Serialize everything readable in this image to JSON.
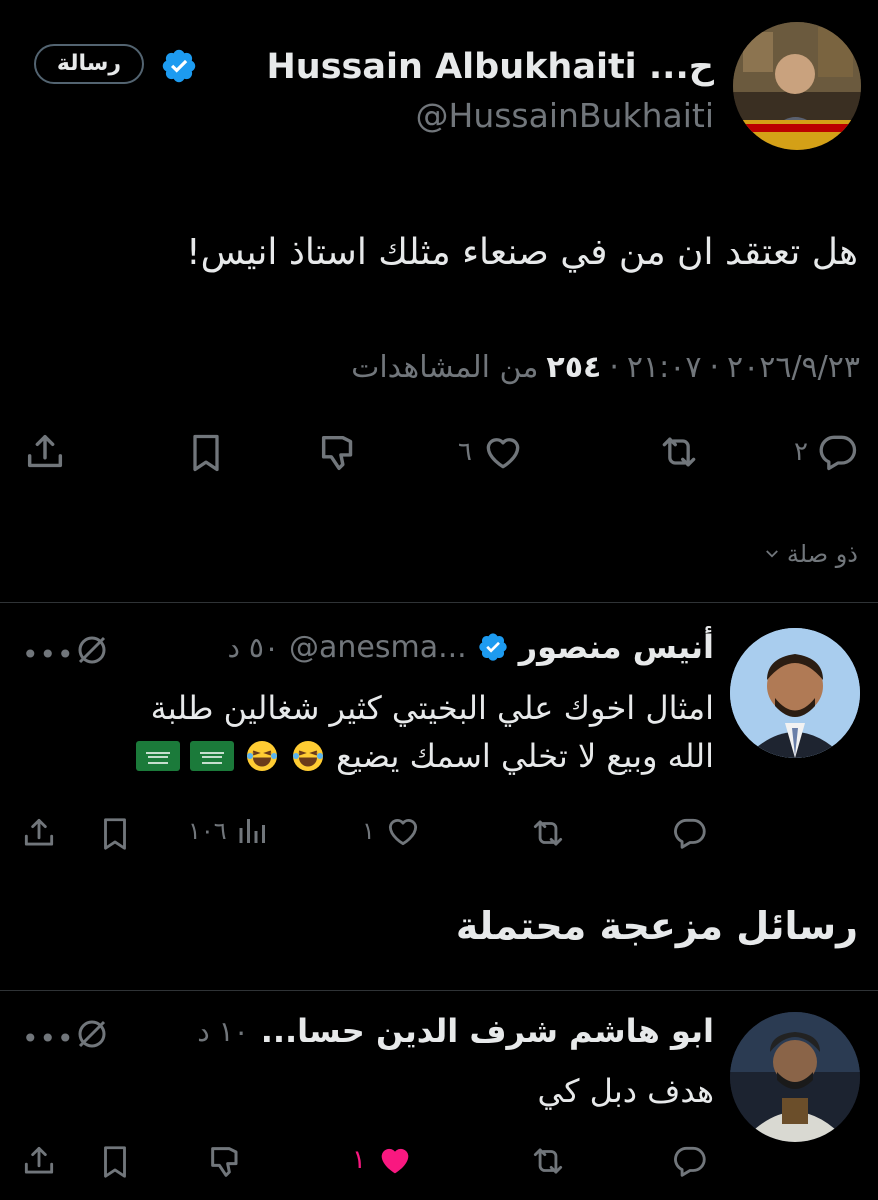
{
  "main_tweet": {
    "display_name": "Hussain Albukhaiti ...ح",
    "handle": "@HussainBukhaiti",
    "message_button": "رسالة",
    "text": "هل تعتقد ان من في صنعاء مثلك استاذ انيس!",
    "meta_date": "٢٠٢٦/٩/٢٣",
    "meta_time": "٢١:٠٧",
    "meta_views": "٢٥٤",
    "meta_views_label": "من المشاهدات",
    "meta_separator": "·",
    "counts": {
      "replies": "٢",
      "likes": "٦"
    }
  },
  "relevance_label": "ذو صلة",
  "reply1": {
    "name": "أنيس منصور",
    "handle": "@anesma...",
    "time": "٥٠ د",
    "text_line1": "امثال اخوك علي البخيتي كثير شغالين طلبة",
    "text_line2": "الله وبيع لا تخلي اسمك يضيع",
    "counts": {
      "likes": "١",
      "views": "١٠٦"
    }
  },
  "section_heading": "رسائل مزعجة محتملة",
  "reply2": {
    "name": "ابو هاشم شرف الدين حسا...",
    "time": "١٠ د",
    "text": "هدف دبل كي",
    "counts": {
      "likes": "١"
    }
  },
  "colors": {
    "background": "#000000",
    "text": "#e7e9ea",
    "muted": "#71767b",
    "verified": "#1d9bf0",
    "like_active": "#f91880",
    "divider": "#2f3336"
  }
}
